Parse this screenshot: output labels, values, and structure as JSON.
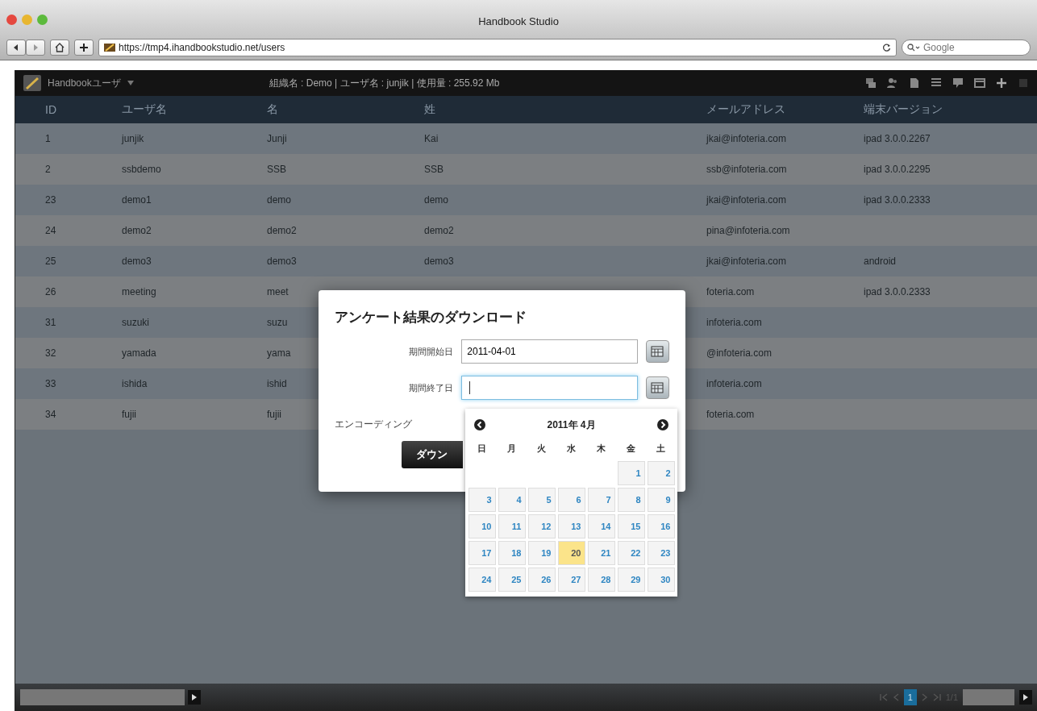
{
  "window": {
    "title": "Handbook Studio"
  },
  "browser": {
    "url": "https://tmp4.ihandbookstudio.net/users",
    "search_placeholder": "Google"
  },
  "app_bar": {
    "title": "Handbookユーザ",
    "info": "組織名 : Demo | ユーザ名 : junjik | 使用量 : 255.92 Mb"
  },
  "table": {
    "columns": [
      "ID",
      "ユーザ名",
      "名",
      "姓",
      "メールアドレス",
      "端末バージョン"
    ],
    "rows": [
      {
        "id": "1",
        "username": "junjik",
        "first_name": "Junji",
        "last_name": "Kai",
        "email": "jkai@infoteria.com",
        "device": "ipad 3.0.0.2267"
      },
      {
        "id": "2",
        "username": "ssbdemo",
        "first_name": "SSB",
        "last_name": "SSB",
        "email": "ssb@infoteria.com",
        "device": "ipad 3.0.0.2295"
      },
      {
        "id": "23",
        "username": "demo1",
        "first_name": "demo",
        "last_name": "demo",
        "email": "jkai@infoteria.com",
        "device": "ipad 3.0.0.2333"
      },
      {
        "id": "24",
        "username": "demo2",
        "first_name": "demo2",
        "last_name": "demo2",
        "email": "pina@infoteria.com"
      },
      {
        "id": "25",
        "username": "demo3",
        "first_name": "demo3",
        "last_name": "demo3",
        "email": "jkai@infoteria.com",
        "device": "android"
      },
      {
        "id": "26",
        "username": "meeting",
        "first_name": "meet",
        "email": "foteria.com",
        "device": "ipad 3.0.0.2333"
      },
      {
        "id": "31",
        "username": "suzuki",
        "first_name": "suzu",
        "email": "infoteria.com"
      },
      {
        "id": "32",
        "username": "yamada",
        "first_name": "yama",
        "email": "@infoteria.com"
      },
      {
        "id": "33",
        "username": "ishida",
        "first_name": "ishid",
        "email": "infoteria.com"
      },
      {
        "id": "34",
        "username": "fujii",
        "first_name": "fujii",
        "email": "foteria.com"
      }
    ]
  },
  "dialog": {
    "title": "アンケート結果のダウンロード",
    "fields": [
      {
        "label": "期間開始日",
        "value": "2011-04-01",
        "focused": false
      },
      {
        "label": "期間終了日",
        "focused": true
      }
    ],
    "encoding_label": "エンコーディング",
    "button": "ダウン"
  },
  "calendar": {
    "title": "2011年 4月",
    "weekdays": [
      "日",
      "月",
      "火",
      "水",
      "木",
      "金",
      "土"
    ],
    "weeks": [
      {
        "days": [
          {
            "day": "1",
            "today": false
          },
          {
            "day": "2",
            "today": false
          }
        ]
      },
      {
        "days": [
          {
            "day": "3",
            "today": false
          },
          {
            "day": "4",
            "today": false
          },
          {
            "day": "5",
            "today": false
          },
          {
            "day": "6",
            "today": false
          },
          {
            "day": "7",
            "today": false
          },
          {
            "day": "8",
            "today": false
          },
          {
            "day": "9",
            "today": false
          }
        ]
      },
      {
        "days": [
          {
            "day": "10",
            "today": false
          },
          {
            "day": "11",
            "today": false
          },
          {
            "day": "12",
            "today": false
          },
          {
            "day": "13",
            "today": false
          },
          {
            "day": "14",
            "today": false
          },
          {
            "day": "15",
            "today": false
          },
          {
            "day": "16",
            "today": false
          }
        ]
      },
      {
        "days": [
          {
            "day": "17",
            "today": false
          },
          {
            "day": "18",
            "today": false
          },
          {
            "day": "19",
            "today": false
          },
          {
            "day": "20",
            "today": true
          },
          {
            "day": "21",
            "today": false
          },
          {
            "day": "22",
            "today": false
          },
          {
            "day": "23",
            "today": false
          }
        ]
      },
      {
        "days": [
          {
            "day": "24",
            "today": false
          },
          {
            "day": "25",
            "today": false
          },
          {
            "day": "26",
            "today": false
          },
          {
            "day": "27",
            "today": false
          },
          {
            "day": "28",
            "today": false
          },
          {
            "day": "29",
            "today": false
          },
          {
            "day": "30",
            "today": false
          }
        ]
      }
    ]
  },
  "pagination": {
    "pages": [
      {
        "label": "1",
        "selected": true
      }
    ],
    "page_count": "1/1"
  }
}
